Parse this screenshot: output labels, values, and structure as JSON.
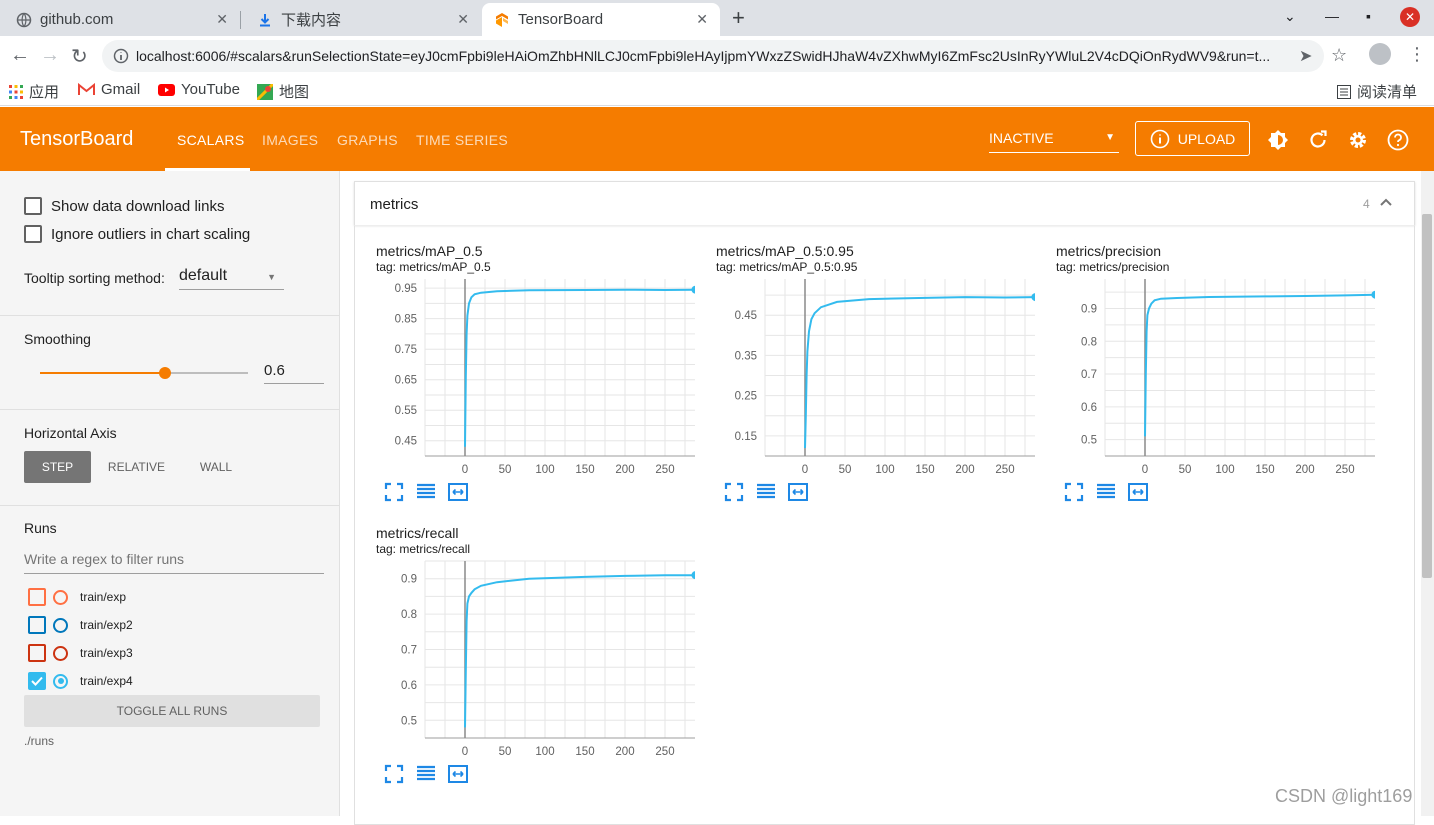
{
  "browser": {
    "tabs": [
      {
        "label": "github.com",
        "active": false
      },
      {
        "label": "下载内容",
        "active": false
      },
      {
        "label": "TensorBoard",
        "active": true
      }
    ],
    "url": "localhost:6006/#scalars&runSelectionState=eyJ0cmFpbi9leHAiOmZhbHNlLCJ0cmFpbi9leHAyIjpmYWxzZSwidHJhaW4vZXhwMyI6ZmFsc2UsInRyYWluL2V4cDQiOnRydWV9&run=t...",
    "bookmarks": [
      {
        "label": "应用",
        "icon": "apps-grid-icon"
      },
      {
        "label": "Gmail",
        "icon": "gmail-icon"
      },
      {
        "label": "YouTube",
        "icon": "youtube-icon"
      },
      {
        "label": "地图",
        "icon": "maps-icon"
      }
    ],
    "reading_list": "阅读清单"
  },
  "header": {
    "brand": "TensorBoard",
    "nav": [
      "SCALARS",
      "IMAGES",
      "GRAPHS",
      "TIME SERIES"
    ],
    "active_nav": "SCALARS",
    "plugin_selector": "INACTIVE",
    "upload_label": "UPLOAD",
    "accent": "#f57c00"
  },
  "sidebar": {
    "show_download_links": "Show data download links",
    "ignore_outliers": "Ignore outliers in chart scaling",
    "tooltip_label": "Tooltip sorting method:",
    "tooltip_value": "default",
    "smoothing_label": "Smoothing",
    "smoothing_value": "0.6",
    "smoothing_fraction": 0.6,
    "horizontal_axis_label": "Horizontal Axis",
    "axis_options": [
      "STEP",
      "RELATIVE",
      "WALL"
    ],
    "axis_selected": "STEP",
    "runs_label": "Runs",
    "runs_filter_placeholder": "Write a regex to filter runs",
    "runs": [
      {
        "name": "train/exp",
        "color": "#ff7043",
        "checked": false
      },
      {
        "name": "train/exp2",
        "color": "#0077bb",
        "checked": false
      },
      {
        "name": "train/exp3",
        "color": "#cc3311",
        "checked": false
      },
      {
        "name": "train/exp4",
        "color": "#33bbee",
        "checked": true
      }
    ],
    "toggle_all": "TOGGLE ALL RUNS",
    "logdir": "./runs"
  },
  "main": {
    "group_name": "metrics",
    "group_count": "4"
  },
  "chart_data": [
    {
      "type": "line",
      "title": "metrics/mAP_0.5",
      "tag": "tag: metrics/mAP_0.5",
      "xlim": [
        -50,
        300
      ],
      "ylim": [
        0.4,
        0.98
      ],
      "xticks": [
        0,
        50,
        100,
        150,
        200,
        250
      ],
      "yticks": [
        0.45,
        0.55,
        0.65,
        0.75,
        0.85,
        0.95
      ],
      "ytick_labels": [
        "0.45",
        "0.55",
        "0.65",
        "0.75",
        "0.85",
        "0.95"
      ],
      "series": [
        {
          "name": "train/exp4",
          "color": "#33bbee",
          "x": [
            0,
            1,
            2,
            3,
            5,
            8,
            12,
            20,
            40,
            80,
            150,
            200,
            250,
            288
          ],
          "y": [
            0.43,
            0.66,
            0.8,
            0.86,
            0.9,
            0.92,
            0.93,
            0.935,
            0.94,
            0.943,
            0.944,
            0.945,
            0.944,
            0.945
          ]
        }
      ]
    },
    {
      "type": "line",
      "title": "metrics/mAP_0.5:0.95",
      "tag": "tag: metrics/mAP_0.5:0.95",
      "xlim": [
        -50,
        300
      ],
      "ylim": [
        0.1,
        0.54
      ],
      "xticks": [
        0,
        50,
        100,
        150,
        200,
        250
      ],
      "yticks": [
        0.15,
        0.25,
        0.35,
        0.45
      ],
      "ytick_labels": [
        "0.15",
        "0.25",
        "0.35",
        "0.45"
      ],
      "series": [
        {
          "name": "train/exp4",
          "color": "#33bbee",
          "x": [
            0,
            1,
            2,
            3,
            5,
            8,
            12,
            20,
            40,
            80,
            150,
            200,
            250,
            288
          ],
          "y": [
            0.12,
            0.2,
            0.3,
            0.36,
            0.41,
            0.44,
            0.455,
            0.47,
            0.483,
            0.49,
            0.493,
            0.495,
            0.494,
            0.495
          ]
        }
      ]
    },
    {
      "type": "line",
      "title": "metrics/precision",
      "tag": "tag: metrics/precision",
      "xlim": [
        -50,
        300
      ],
      "ylim": [
        0.45,
        0.99
      ],
      "xticks": [
        0,
        50,
        100,
        150,
        200,
        250
      ],
      "yticks": [
        0.5,
        0.6,
        0.7,
        0.8,
        0.9
      ],
      "ytick_labels": [
        "0.5",
        "0.6",
        "0.7",
        "0.8",
        "0.9"
      ],
      "series": [
        {
          "name": "train/exp4",
          "color": "#33bbee",
          "x": [
            0,
            1,
            2,
            3,
            5,
            8,
            12,
            20,
            40,
            80,
            150,
            200,
            250,
            288
          ],
          "y": [
            0.51,
            0.7,
            0.83,
            0.88,
            0.9,
            0.915,
            0.925,
            0.93,
            0.932,
            0.935,
            0.937,
            0.938,
            0.94,
            0.942
          ]
        }
      ]
    },
    {
      "type": "line",
      "title": "metrics/recall",
      "tag": "tag: metrics/recall",
      "xlim": [
        -50,
        300
      ],
      "ylim": [
        0.45,
        0.95
      ],
      "xticks": [
        0,
        50,
        100,
        150,
        200,
        250
      ],
      "yticks": [
        0.5,
        0.6,
        0.7,
        0.8,
        0.9
      ],
      "ytick_labels": [
        "0.5",
        "0.6",
        "0.7",
        "0.8",
        "0.9"
      ],
      "series": [
        {
          "name": "train/exp4",
          "color": "#33bbee",
          "x": [
            0,
            1,
            2,
            3,
            5,
            8,
            12,
            20,
            40,
            80,
            150,
            200,
            250,
            288
          ],
          "y": [
            0.48,
            0.64,
            0.78,
            0.83,
            0.85,
            0.86,
            0.87,
            0.88,
            0.89,
            0.9,
            0.905,
            0.908,
            0.91,
            0.91
          ]
        }
      ]
    }
  ],
  "watermark": "CSDN @light169"
}
